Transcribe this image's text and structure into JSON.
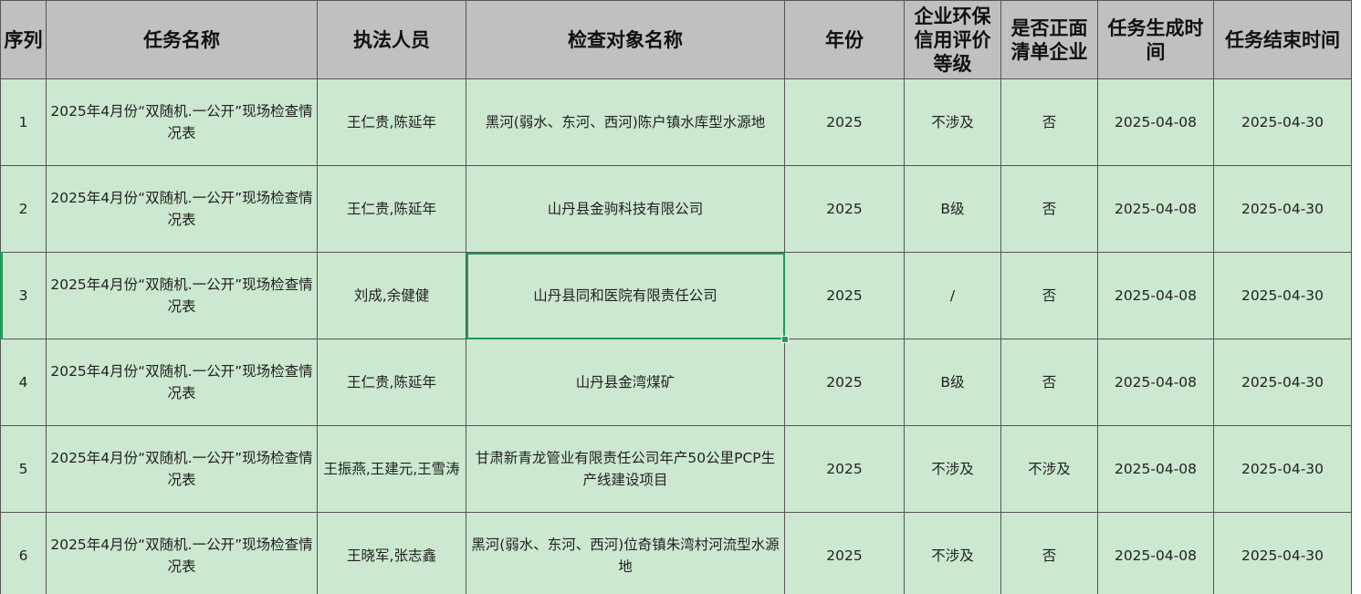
{
  "columns": [
    "序列",
    "任务名称",
    "执法人员",
    "检查对象名称",
    "年份",
    "企业环保信用评价等级",
    "是否正面清单企业",
    "任务生成时间",
    "任务结束时间"
  ],
  "rows": [
    {
      "seq": "1",
      "task": "2025年4月份“双随机.一公开”现场检查情况表",
      "staff": "王仁贵,陈延年",
      "target": "黑河(弱水、东河、西河)陈户镇水库型水源地",
      "year": "2025",
      "credit": "不涉及",
      "positive": "否",
      "start": "2025-04-08",
      "end": "2025-04-30"
    },
    {
      "seq": "2",
      "task": "2025年4月份“双随机.一公开”现场检查情况表",
      "staff": "王仁贵,陈延年",
      "target": "山丹县金驹科技有限公司",
      "year": "2025",
      "credit": "B级",
      "positive": "否",
      "start": "2025-04-08",
      "end": "2025-04-30"
    },
    {
      "seq": "3",
      "task": "2025年4月份“双随机.一公开”现场检查情况表",
      "staff": "刘成,余健健",
      "target": "山丹县同和医院有限责任公司",
      "year": "2025",
      "credit": "/",
      "positive": "否",
      "start": "2025-04-08",
      "end": "2025-04-30"
    },
    {
      "seq": "4",
      "task": "2025年4月份“双随机.一公开”现场检查情况表",
      "staff": "王仁贵,陈延年",
      "target": "山丹县金湾煤矿",
      "year": "2025",
      "credit": "B级",
      "positive": "否",
      "start": "2025-04-08",
      "end": "2025-04-30"
    },
    {
      "seq": "5",
      "task": "2025年4月份“双随机.一公开”现场检查情况表",
      "staff": "王振燕,王建元,王雪涛",
      "target": "甘肃新青龙管业有限责任公司年产50公里PCP生产线建设项目",
      "year": "2025",
      "credit": "不涉及",
      "positive": "不涉及",
      "start": "2025-04-08",
      "end": "2025-04-30"
    },
    {
      "seq": "6",
      "task": "2025年4月份“双随机.一公开”现场检查情况表",
      "staff": "王晓军,张志鑫",
      "target": "黑河(弱水、东河、西河)位奇镇朱湾村河流型水源地",
      "year": "2025",
      "credit": "不涉及",
      "positive": "否",
      "start": "2025-04-08",
      "end": "2025-04-30"
    }
  ],
  "selected_cell": {
    "row": "3",
    "column": "检查对象名称"
  }
}
